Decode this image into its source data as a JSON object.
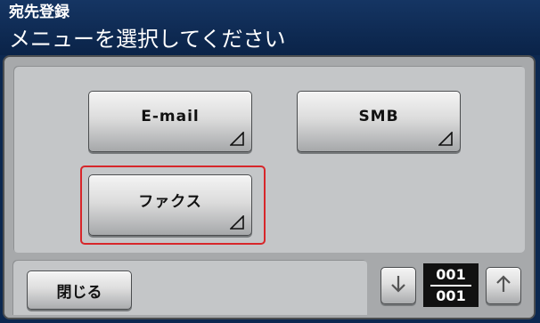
{
  "header": {
    "subtitle": "宛先登録",
    "title": "メニューを選択してください"
  },
  "menu": {
    "buttons": [
      {
        "id": "email",
        "label": "E-mail",
        "selected": false
      },
      {
        "id": "smb",
        "label": "SMB",
        "selected": false
      },
      {
        "id": "fax",
        "label": "ファクス",
        "selected": true
      }
    ]
  },
  "footer": {
    "close_label": "閉じる",
    "page_current": "001",
    "page_total": "001",
    "down_icon": "arrow-down-icon",
    "up_icon": "arrow-up-icon"
  },
  "colors": {
    "header_bg": "#0c2850",
    "panel_bg": "#a7a9ab",
    "content_bg": "#c4c6c8",
    "selection": "#d7262a"
  }
}
